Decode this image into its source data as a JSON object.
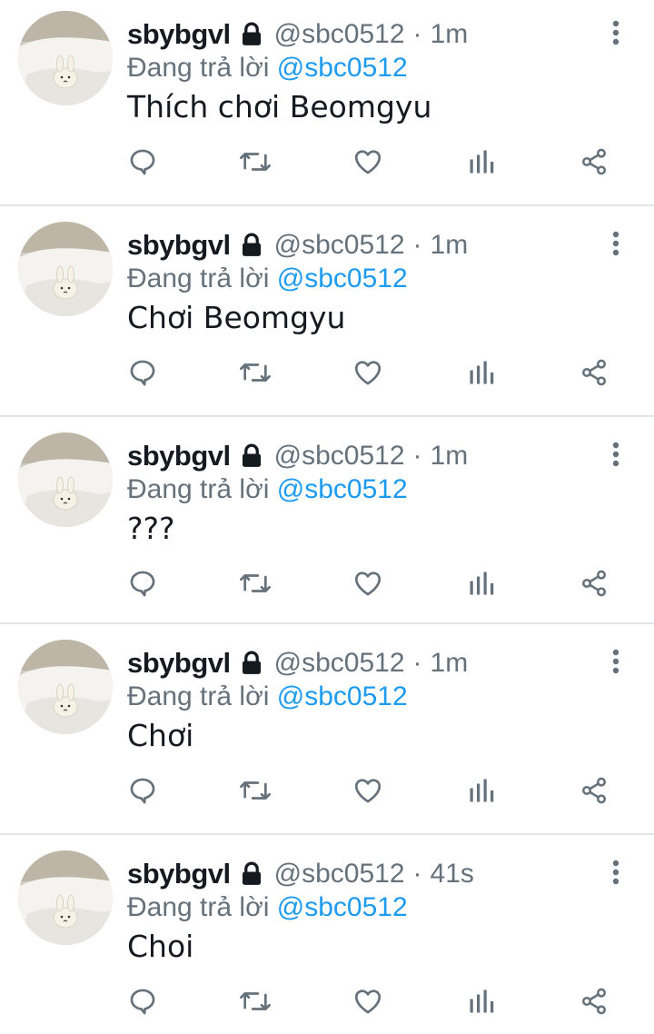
{
  "tweets": [
    {
      "name": "sbybgvl",
      "handle": "@sbc0512",
      "time": "1m",
      "reply_prefix": "Đang trả lời",
      "reply_to": "@sbc0512",
      "text": "Thích chơi Beomgyu"
    },
    {
      "name": "sbybgvl",
      "handle": "@sbc0512",
      "time": "1m",
      "reply_prefix": "Đang trả lời",
      "reply_to": "@sbc0512",
      "text": "Chơi Beomgyu"
    },
    {
      "name": "sbybgvl",
      "handle": "@sbc0512",
      "time": "1m",
      "reply_prefix": "Đang trả lời",
      "reply_to": "@sbc0512",
      "text": "???"
    },
    {
      "name": "sbybgvl",
      "handle": "@sbc0512",
      "time": "1m",
      "reply_prefix": "Đang trả lời",
      "reply_to": "@sbc0512",
      "text": "Chơi"
    },
    {
      "name": "sbybgvl",
      "handle": "@sbc0512",
      "time": "41s",
      "reply_prefix": "Đang trả lời",
      "reply_to": "@sbc0512",
      "text": "Choi"
    }
  ],
  "separator": "·",
  "icons": {
    "lock": "lock-icon",
    "more": "more-vertical-icon",
    "actions": [
      "reply-icon",
      "retweet-icon",
      "like-icon",
      "views-icon",
      "share-icon"
    ]
  },
  "colors": {
    "text": "#141a1f",
    "secondary": "#65717b",
    "mention": "#1d9bf0",
    "divider": "#e3e6e8"
  }
}
